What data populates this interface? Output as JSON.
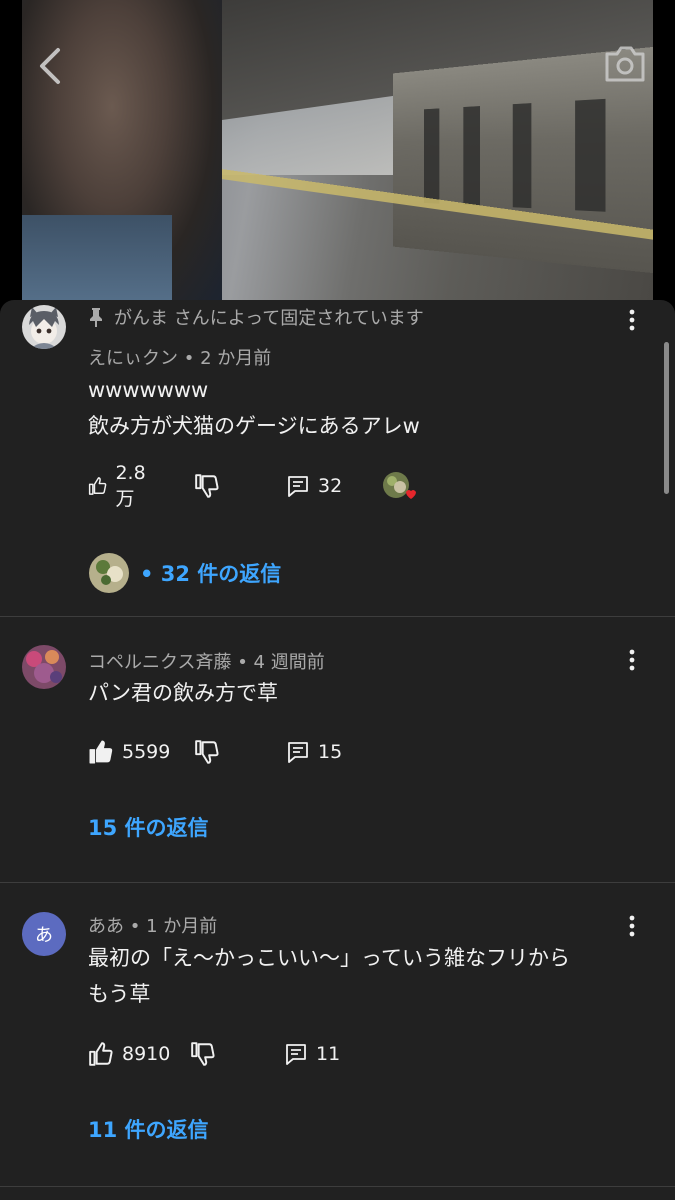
{
  "video": {
    "back_icon": "chevron-left-icon",
    "camera_icon": "camera-icon"
  },
  "comments": [
    {
      "pinned_text": "がんま さんによって固定されています",
      "author": "えにぃクン",
      "time": "2 か月前",
      "lines": [
        "wwwwwww",
        "飲み方が犬猫のゲージにあるアレw"
      ],
      "likes": "2.8万",
      "reply_count": "32",
      "replies_label": "• 32 件の返信",
      "liked": false,
      "creator_heart": true
    },
    {
      "author": "コペルニクス斉藤",
      "time": "4 週間前",
      "lines": [
        "パン君の飲み方で草"
      ],
      "likes": "5599",
      "reply_count": "15",
      "replies_label": "15 件の返信",
      "liked": true
    },
    {
      "author": "ああ",
      "avatar_letter": "あ",
      "avatar_color": "#5c6bc0",
      "time": "1 か月前",
      "lines": [
        "最初の「え〜かっこいい〜」っていう雑なフリから",
        "もう草"
      ],
      "likes": "8910",
      "reply_count": "11",
      "replies_label": "11 件の返信",
      "liked": false
    }
  ],
  "colors": {
    "sheet_bg": "#212121",
    "link": "#3ea6ff",
    "meta": "#aaaaaa",
    "text": "#f1f1f1"
  }
}
